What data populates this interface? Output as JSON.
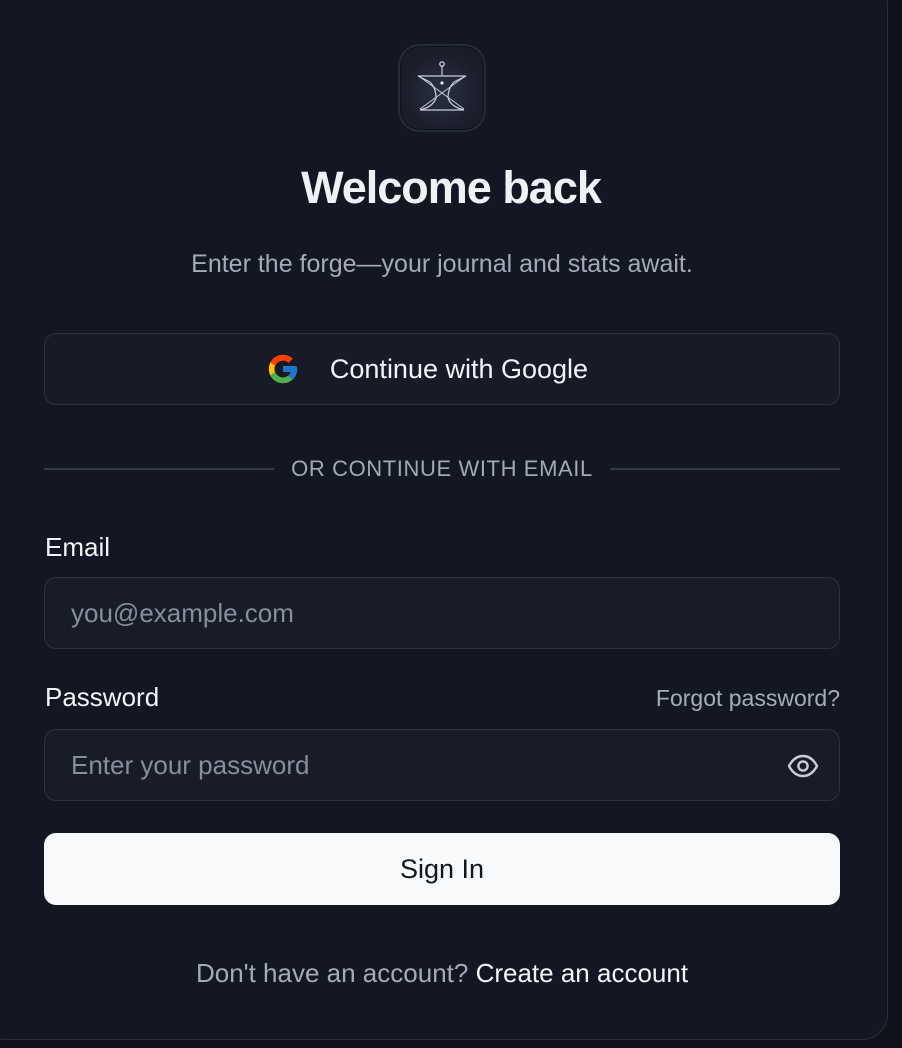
{
  "header": {
    "logo": "anvil-logo-icon",
    "title": "Welcome back",
    "subtitle": "Enter the forge—your journal and stats await."
  },
  "oauth": {
    "google_label": "Continue with Google",
    "google_icon": "google-icon"
  },
  "divider": {
    "text": "OR CONTINUE WITH EMAIL"
  },
  "form": {
    "email_label": "Email",
    "email_placeholder": "you@example.com",
    "email_value": "",
    "password_label": "Password",
    "password_placeholder": "Enter your password",
    "password_value": "",
    "forgot_label": "Forgot password?",
    "toggle_icon": "eye-icon",
    "submit_label": "Sign In"
  },
  "footer": {
    "prompt": "Don't have an account?",
    "link": "Create an account"
  },
  "colors": {
    "background": "#121723",
    "field_background": "#171c28",
    "border": "#2c323e",
    "primary_button": "#f8f9fa",
    "muted_text": "#a4abb8"
  }
}
